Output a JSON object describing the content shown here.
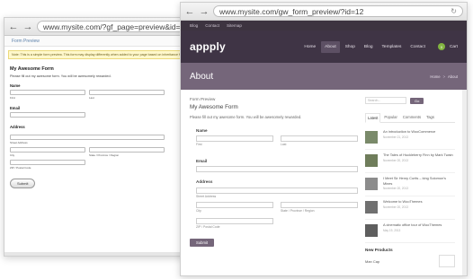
{
  "back_window": {
    "url": "www.mysite.com/?gf_page=preview&id=12",
    "title_bar": "Form Preview",
    "notice": "Note: This is a simple form preview. This form may display differently when added to your page based on inheritance from individual theme styles.",
    "form_title": "My Awesome Form",
    "form_description": "Please fill out my awesome form. You will be awesomely rewarded.",
    "name_label": "Name",
    "first_sub": "First",
    "last_sub": "Last",
    "email_label": "Email",
    "address_label": "Address",
    "street_sub": "Street Address",
    "city_sub": "City",
    "state_sub": "State / Province / Region",
    "zip_sub": "ZIP / Postal Code",
    "submit_label": "Submit"
  },
  "front_window": {
    "url": "www.mysite.com/gw_form_preview/?id=12",
    "topbar": [
      "Blog",
      "Contact",
      "Sitemap"
    ],
    "logo": "appply",
    "nav": [
      {
        "label": "Home",
        "active": false
      },
      {
        "label": "About",
        "active": true
      },
      {
        "label": "Shop",
        "active": false
      },
      {
        "label": "Blog",
        "active": false
      },
      {
        "label": "Templates",
        "active": false
      },
      {
        "label": "Contact",
        "active": false
      }
    ],
    "cart_count": "0",
    "cart_label": "Cart",
    "hero_title": "About",
    "breadcrumb": [
      "Home",
      "About"
    ],
    "form_preview_label": "Form Preview",
    "form_title": "My Awesome Form",
    "form_description": "Please fill out my awesome form. You will be awesomely rewarded.",
    "name_label": "Name",
    "first_sub": "First",
    "last_sub": "Last",
    "email_label": "Email",
    "address_label": "Address",
    "street_sub": "Street Address",
    "city_sub": "City",
    "state_sub": "State / Province / Region",
    "zip_sub": "ZIP / Postal Code",
    "submit_label": "Submit",
    "search_placeholder": "Search...",
    "go_label": "Go",
    "tabs": [
      "Latest",
      "Popular",
      "Comments",
      "Tags"
    ],
    "posts": [
      {
        "title": "An introduction to WooCommerce",
        "date": "November 21, 2013"
      },
      {
        "title": "The Tales of Huckleberry Finn by Mark Twain",
        "date": "November 20, 2013"
      },
      {
        "title": "I Meet Sir Henry Curtis – king Solomon's Mines",
        "date": "November 20, 2013"
      },
      {
        "title": "Welcome to WooThemes",
        "date": "November 20, 2013"
      },
      {
        "title": "A cinematic office tour of WooThemes",
        "date": "May 19, 2013"
      }
    ],
    "new_products_label": "New Products",
    "new_product_item": "Man Cap"
  },
  "colors": {
    "header_bg": "#3f3445",
    "hero_bg": "#75667a",
    "accent_button": "#75667a",
    "cart_badge": "#82b440"
  }
}
